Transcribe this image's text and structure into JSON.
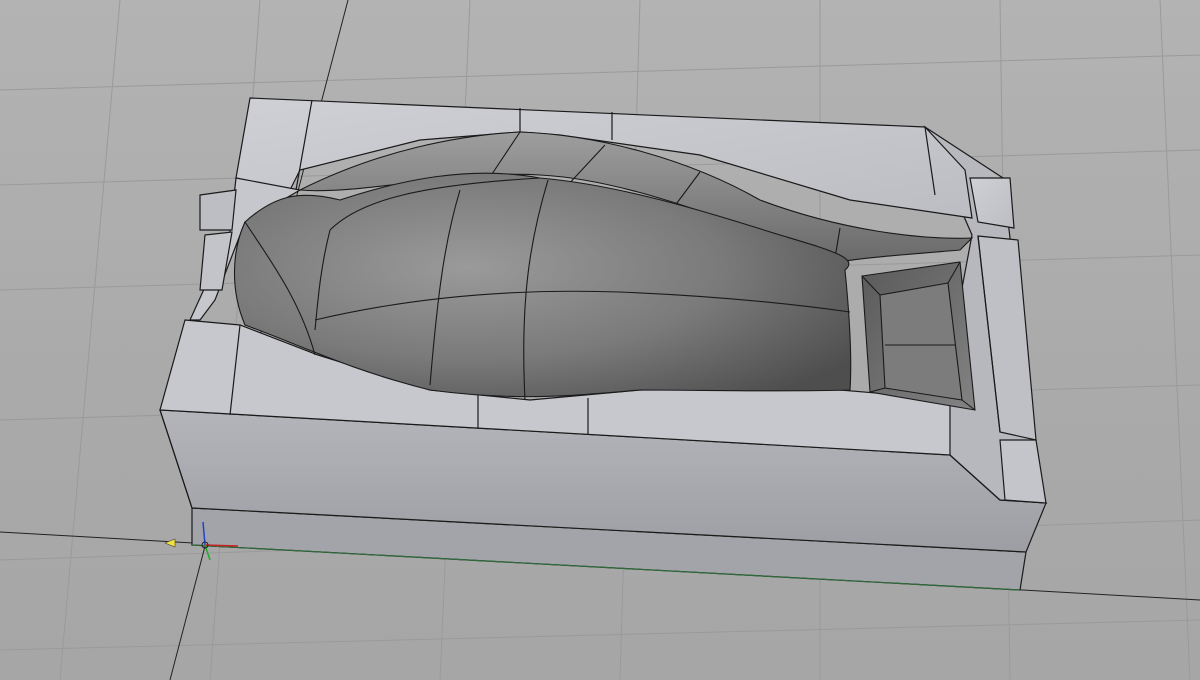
{
  "viewport": {
    "background_color": "#aaaaaa",
    "grid_line_color": "#9a9a9a",
    "axis_line_color": "#222222",
    "edge_color": "#1a1a1a",
    "ground_edge_color": "#2f6b3a"
  },
  "model": {
    "name": "",
    "face_colors": {
      "top_rim": "#c2c3c8",
      "front_wall": "#a9aab0",
      "base": "#9c9da3",
      "cavity_light": "#8e8e8e",
      "cavity_dark": "#555555",
      "pocket": "#6e6e6e"
    }
  },
  "triad": {
    "icon": "coordinate-triad-icon",
    "x_color": "#cc2222",
    "y_color": "#22aa22",
    "z_color": "#2244cc",
    "origin_marker_color": "#f2e23a"
  }
}
